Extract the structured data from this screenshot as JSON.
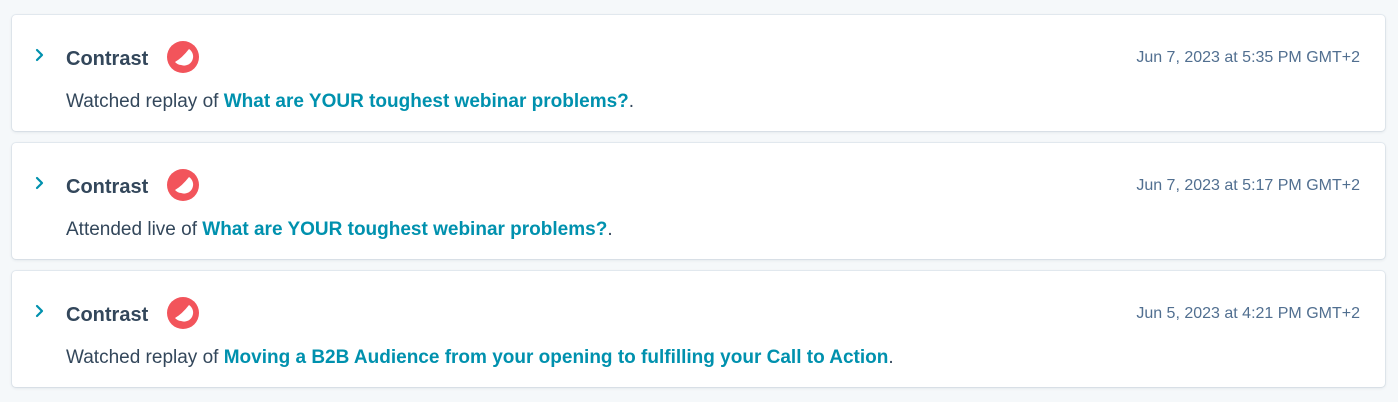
{
  "colors": {
    "background": "#f5f8fa",
    "card": "#ffffff",
    "heading": "#33475b",
    "timestamp": "#516f90",
    "link": "#0091ae",
    "icon": "#f2545b"
  },
  "events": [
    {
      "source": "Contrast",
      "icon": "contrast-app-icon",
      "timestamp": "Jun 7, 2023 at 5:35 PM GMT+2",
      "action": "Watched replay of ",
      "link": "What are YOUR toughest webinar problems?",
      "suffix": "."
    },
    {
      "source": "Contrast",
      "icon": "contrast-app-icon",
      "timestamp": "Jun 7, 2023 at 5:17 PM GMT+2",
      "action": "Attended live of ",
      "link": "What are YOUR toughest webinar problems?",
      "suffix": "."
    },
    {
      "source": "Contrast",
      "icon": "contrast-app-icon",
      "timestamp": "Jun 5, 2023 at 4:21 PM GMT+2",
      "action": "Watched replay of ",
      "link": "Moving a B2B Audience from your opening to fulfilling your Call to Action",
      "suffix": "."
    }
  ]
}
